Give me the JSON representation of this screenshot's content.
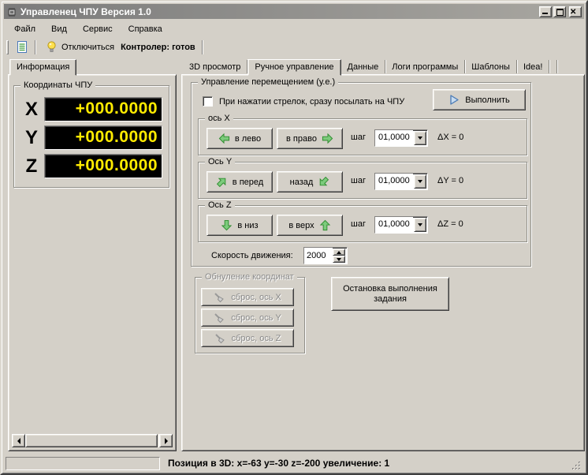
{
  "window": {
    "title": "Управленец ЧПУ Версия 1.0"
  },
  "menu": {
    "items": [
      "Файл",
      "Вид",
      "Сервис",
      "Справка"
    ]
  },
  "toolbar": {
    "disconnect": "Отключиться",
    "controller_status": "Контролер: готов"
  },
  "left_panel": {
    "tab_label": "Информация",
    "coords_group": "Координаты ЧПУ",
    "axes": [
      {
        "label": "X",
        "value": "+000.0000"
      },
      {
        "label": "Y",
        "value": "+000.0000"
      },
      {
        "label": "Z",
        "value": "+000.0000"
      }
    ]
  },
  "right_tabs": [
    "3D просмотр",
    "Ручное управление",
    "Данные",
    "Логи программы",
    "Шаблоны",
    "Idea!"
  ],
  "active_tab": "Ручное управление",
  "manual": {
    "group_title": "Управление перемещением (у.е.)",
    "checkbox_label": "При нажатии стрелок, сразу посылать на ЧПУ",
    "checkbox_checked": false,
    "execute": "Выполнить",
    "step_label": "шаг",
    "axis_x": {
      "title": "ось X",
      "neg": "в лево",
      "pos": "в право",
      "step": "01,0000",
      "delta": "ΔX = 0"
    },
    "axis_y": {
      "title": "Ось Y",
      "neg": "в перед",
      "pos": "назад",
      "step": "01,0000",
      "delta": "ΔY = 0"
    },
    "axis_z": {
      "title": "Ось Z",
      "neg": "в низ",
      "pos": "в верх",
      "step": "01,0000",
      "delta": "ΔZ = 0"
    },
    "speed_label": "Скорость движения:",
    "speed_value": "2000"
  },
  "reset_group": {
    "title": "Обнуление координат",
    "enabled": false,
    "buttons": [
      "сброс, ось X",
      "сброс, ось Y",
      "сброс, ось Z"
    ]
  },
  "stop_button": "Остановка выполнения задания",
  "status": {
    "text": "Позиция в 3D: x=-63 y=-30 z=-200 увеличение: 1"
  },
  "colors": {
    "window_bg": "#d4d0c8",
    "title_gradient_start": "#7b7b7b",
    "title_gradient_end": "#a9a7a1",
    "title_text": "#ffffff",
    "lcd_bg": "#000000",
    "lcd_text": "#ffeb00",
    "arrow_green": "#7ccb7c",
    "play_blue": "#c8dcf0",
    "bulb_yellow": "#ffe04d",
    "disabled_text": "#8a8a8a"
  },
  "icons": {
    "window-icon": "chip",
    "report-icon": "document-with-table",
    "bulb-icon": "lightbulb",
    "play-icon": "play-triangle-outline",
    "axis-arrow-icon": "green-block-arrow",
    "broom-icon": "gray-broom",
    "combo-arrow-icon": "▼",
    "spinner-icons": "▲▼",
    "scroll-arrow-icons": "◄ ►",
    "resize-grip-icon": "dot-grid"
  }
}
